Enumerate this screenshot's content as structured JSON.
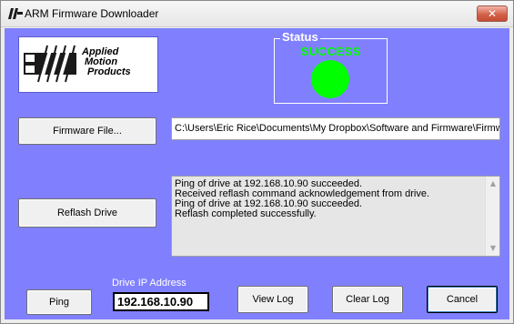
{
  "window": {
    "title": "ARM Firmware Downloader",
    "close_glyph": "✕",
    "app_icon": "arm-chip-icon"
  },
  "logo": {
    "line1": "Applied",
    "line2": "Motion",
    "line3": "Products",
    "icon": "leadscrew-logo-icon"
  },
  "status": {
    "title": "Status",
    "text": "SUCCESS",
    "light_color": "#00ff00"
  },
  "firmware": {
    "button_label": "Firmware File...",
    "path_value": "C:\\Users\\Eric Rice\\Documents\\My Dropbox\\Software and Firmware\\Firmw"
  },
  "reflash": {
    "button_label": "Reflash Drive"
  },
  "log": {
    "lines": [
      "Ping of drive at 192.168.10.90 succeeded.",
      "Received reflash command acknowledgement from drive.",
      "Ping of drive at 192.168.10.90 succeeded.",
      "Reflash completed successfully."
    ],
    "scroll_up_glyph": "▲",
    "scroll_down_glyph": "▼"
  },
  "ip": {
    "label": "Drive IP Address",
    "value": "192.168.10.90"
  },
  "buttons": {
    "ping": "Ping",
    "view_log": "View Log",
    "clear_log": "Clear Log",
    "cancel": "Cancel"
  },
  "colors": {
    "client_bg": "#8080ff",
    "status_green": "#00ff00"
  }
}
